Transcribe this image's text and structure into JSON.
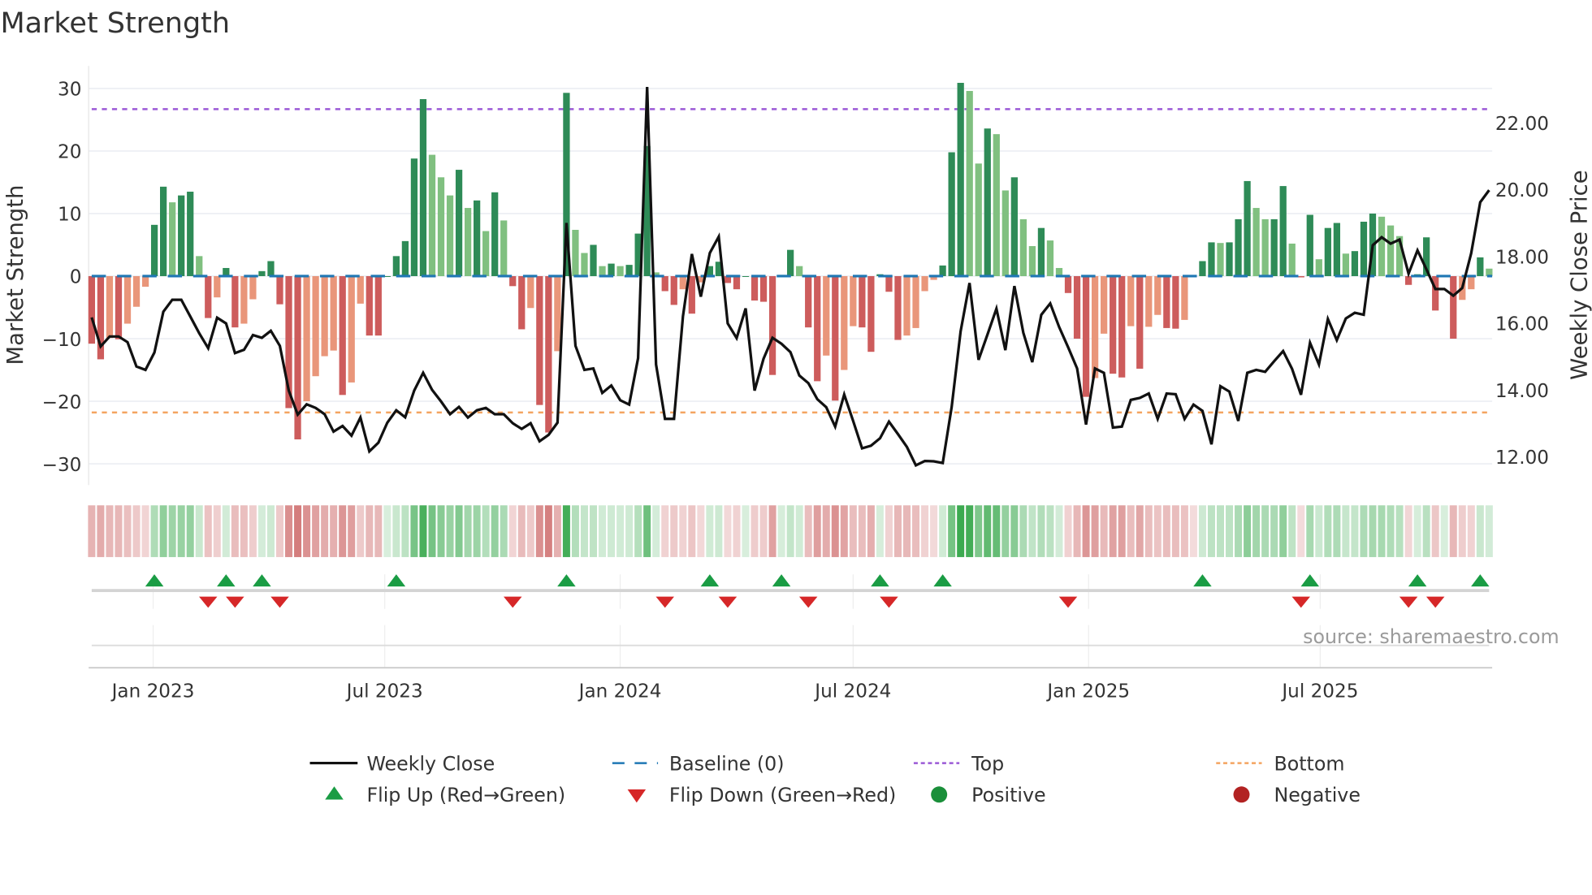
{
  "chart_data": {
    "type": "bar",
    "title": "Market Strength",
    "ylabel": "Market Strength",
    "y2label": "Weekly Close Price",
    "start_week": "2022-11-14",
    "ylim": [
      -33.4,
      33.6
    ],
    "y2lim": [
      11.15,
      23.7
    ],
    "top_level": 26.7,
    "bottom_level": -21.8,
    "baseline_level": 0,
    "grid": true,
    "legend_position": "bottom",
    "colors": {
      "bar_up_strong": "#2e8b57",
      "bar_up_weak": "#80c080",
      "bar_down_strong": "#cd5c5c",
      "bar_down_weak": "#e9967a",
      "price_line": "#111111",
      "baseline": "#1f77b4",
      "top": "#9b59d6",
      "bottom": "#f4a460",
      "flip_up": "#1a9c44",
      "flip_down": "#d62728",
      "positive": "#1a8f3a",
      "negative": "#b22222"
    },
    "strength": [
      -10.8,
      -13.3,
      -9.9,
      -10.1,
      -7.6,
      -4.9,
      -1.7,
      8.2,
      14.3,
      11.8,
      12.9,
      13.5,
      3.2,
      -6.7,
      -3.4,
      1.3,
      -8.2,
      -7.6,
      -3.7,
      0.8,
      2.4,
      -4.5,
      -21.1,
      -26.1,
      -20,
      -16,
      -12.8,
      -11.9,
      -19,
      -17,
      -4.4,
      -9.5,
      -9.5,
      0,
      3.2,
      5.6,
      18.8,
      28.3,
      19.4,
      15.8,
      12.9,
      17,
      10.9,
      12.1,
      7.2,
      13.4,
      8.9,
      -1.6,
      -8.5,
      -5.1,
      -20.6,
      -25,
      -12,
      29.3,
      7.4,
      3.7,
      5,
      1.6,
      2,
      1.6,
      1.8,
      6.8,
      20.8,
      0.6,
      -2.4,
      -4.6,
      -2.1,
      -6,
      -1,
      1.6,
      2.3,
      -1.1,
      -2.1,
      0,
      -3.9,
      -4.1,
      -15.8,
      0.2,
      4.2,
      1.6,
      -8.2,
      -16.8,
      -12.7,
      -19.9,
      -15,
      -8,
      -8.2,
      -12.1,
      0.3,
      -2.5,
      -10.2,
      -9.5,
      -8.3,
      -2.4,
      -0.6,
      1.7,
      19.8,
      30.9,
      29.6,
      18,
      23.6,
      22.7,
      13.7,
      15.8,
      9.1,
      4.8,
      7.7,
      5.7,
      1.3,
      -2.7,
      -10,
      -19.3,
      -16.3,
      -9.2,
      -15.6,
      -16.2,
      -8,
      -14.8,
      -8.1,
      -6.2,
      -8.3,
      -8.4,
      -7,
      -0.1,
      2.4,
      5.4,
      5.3,
      5.4,
      9.1,
      15.2,
      10.9,
      9.1,
      9.1,
      14.4,
      5.2,
      -0.2,
      9.8,
      2.7,
      7.7,
      8.5,
      3.6,
      4,
      8.7,
      10,
      9.5,
      8.1,
      6.4,
      -1.4,
      0.3,
      6.2,
      -5.5,
      0,
      -10,
      -3.8,
      -2.1,
      3,
      1.2
    ],
    "weekly_close": [
      16.17,
      15.3,
      15.6,
      15.6,
      15.43,
      14.7,
      14.6,
      15.12,
      16.34,
      16.7,
      16.7,
      16.2,
      15.7,
      15.25,
      16.16,
      15.99,
      15.1,
      15.2,
      15.64,
      15.56,
      15.77,
      15.32,
      13.98,
      13.26,
      13.57,
      13.46,
      13.27,
      12.75,
      12.92,
      12.63,
      13.17,
      12.16,
      12.42,
      13.02,
      13.39,
      13.18,
      13.98,
      14.51,
      14.0,
      13.65,
      13.27,
      13.49,
      13.17,
      13.39,
      13.46,
      13.27,
      13.27,
      13.0,
      12.83,
      13.0,
      12.46,
      12.65,
      13.02,
      19.0,
      15.32,
      14.6,
      14.64,
      13.91,
      14.13,
      13.69,
      13.56,
      14.95,
      23.07,
      14.76,
      13.13,
      13.13,
      16.2,
      18.07,
      16.79,
      18.1,
      18.59,
      15.99,
      15.55,
      16.44,
      13.98,
      14.93,
      15.56,
      15.38,
      15.13,
      14.43,
      14.2,
      13.72,
      13.48,
      12.9,
      13.86,
      13.07,
      12.25,
      12.33,
      12.55,
      13.05,
      12.68,
      12.29,
      11.74,
      11.87,
      11.86,
      11.81,
      13.49,
      15.75,
      17.2,
      14.9,
      15.66,
      16.43,
      15.19,
      17.11,
      15.71,
      14.83,
      16.25,
      16.59,
      15.88,
      15.28,
      14.64,
      12.96,
      14.64,
      14.51,
      12.87,
      12.9,
      13.7,
      13.76,
      13.89,
      13.13,
      13.89,
      13.87,
      13.13,
      13.56,
      13.37,
      12.37,
      14.11,
      13.95,
      13.07,
      14.51,
      14.6,
      14.54,
      14.86,
      15.16,
      14.63,
      13.85,
      15.41,
      14.76,
      16.12,
      15.49,
      16.14,
      16.31,
      16.25,
      18.33,
      18.57,
      18.38,
      18.5,
      17.48,
      18.18,
      17.61,
      17.02,
      17.02,
      16.82,
      17.05,
      18.09,
      19.62,
      19.98
    ],
    "flip_up_weeks": [
      8,
      16,
      20,
      35,
      54,
      70,
      78,
      89,
      96,
      125,
      137,
      149,
      156
    ],
    "flip_down_weeks": [
      14,
      17,
      22,
      48,
      65,
      72,
      81,
      90,
      110,
      136,
      148,
      151
    ],
    "y_ticks_left": [
      {
        "value": 30,
        "label": "30"
      },
      {
        "value": 20,
        "label": "20"
      },
      {
        "value": 10,
        "label": "10"
      },
      {
        "value": 0,
        "label": "0"
      },
      {
        "value": -10,
        "label": "−10"
      },
      {
        "value": -20,
        "label": "−20"
      },
      {
        "value": -30,
        "label": "−30"
      }
    ],
    "y_ticks_right": [
      {
        "value": 22,
        "label": "22.00"
      },
      {
        "value": 20,
        "label": "20.00"
      },
      {
        "value": 18,
        "label": "18.00"
      },
      {
        "value": 16,
        "label": "16.00"
      },
      {
        "value": 14,
        "label": "14.00"
      },
      {
        "value": 12,
        "label": "12.00"
      }
    ],
    "x_ticks": [
      {
        "date": "2023-01-01",
        "label": "Jan 2023"
      },
      {
        "date": "2023-07-01",
        "label": "Jul 2023"
      },
      {
        "date": "2024-01-01",
        "label": "Jan 2024"
      },
      {
        "date": "2024-07-01",
        "label": "Jul 2024"
      },
      {
        "date": "2025-01-01",
        "label": "Jan 2025"
      },
      {
        "date": "2025-07-01",
        "label": "Jul 2025"
      }
    ],
    "legend": {
      "weekly_close": "Weekly Close",
      "baseline": "Baseline (0)",
      "top": "Top",
      "bottom": "Bottom",
      "flip_up": "Flip Up (Red→Green)",
      "flip_down": "Flip Down (Green→Red)",
      "positive": "Positive",
      "negative": "Negative"
    },
    "source": "source: sharemaestro.com"
  }
}
